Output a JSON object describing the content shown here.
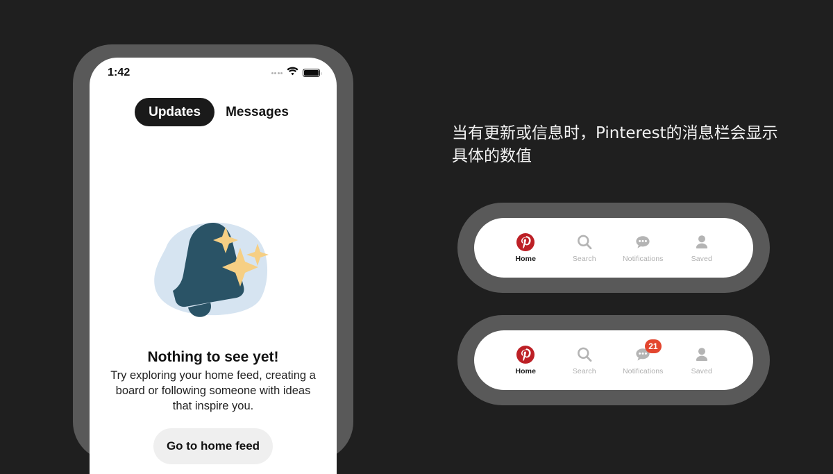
{
  "page": {
    "background_color": "#1f1f1f",
    "caption": "当有更新或信息时，Pinterest的消息栏会显示具体的数值"
  },
  "phone": {
    "frame_color": "#595959",
    "status_bar": {
      "time": "1:42",
      "signal_icon": "signal-dots-icon",
      "wifi_icon": "wifi-icon",
      "battery_icon": "battery-full-icon"
    },
    "tabs": [
      {
        "label": "Updates",
        "active": true
      },
      {
        "label": "Messages",
        "active": false
      }
    ],
    "empty_state": {
      "illustration": "bell-sparkles-illustration",
      "illustration_colors": {
        "blob": "#d6e4f1",
        "bell": "#2a5366",
        "sparkle": "#f6cf84"
      },
      "title": "Nothing to see yet!",
      "body": "Try exploring your home feed, creating a board or following someone with ideas that inspire you.",
      "button_label": "Go to home feed"
    }
  },
  "navbars": [
    {
      "id": "navbar-without-badge",
      "items": [
        {
          "label": "Home",
          "icon": "pinterest-logo-icon",
          "active": true,
          "badge": ""
        },
        {
          "label": "Search",
          "icon": "search-icon",
          "active": false,
          "badge": ""
        },
        {
          "label": "Notifications",
          "icon": "speech-bubble-icon",
          "active": false,
          "badge": ""
        },
        {
          "label": "Saved",
          "icon": "person-icon",
          "active": false,
          "badge": ""
        }
      ]
    },
    {
      "id": "navbar-with-badge",
      "items": [
        {
          "label": "Home",
          "icon": "pinterest-logo-icon",
          "active": true,
          "badge": ""
        },
        {
          "label": "Search",
          "icon": "search-icon",
          "active": false,
          "badge": ""
        },
        {
          "label": "Notifications",
          "icon": "speech-bubble-icon",
          "active": false,
          "badge": "21"
        },
        {
          "label": "Saved",
          "icon": "person-icon",
          "active": false,
          "badge": ""
        }
      ]
    }
  ],
  "colors": {
    "pinterest_red": "#bd2026",
    "badge_red": "#e3462f",
    "icon_grey": "#b4b4b4",
    "frame_grey": "#595959"
  }
}
